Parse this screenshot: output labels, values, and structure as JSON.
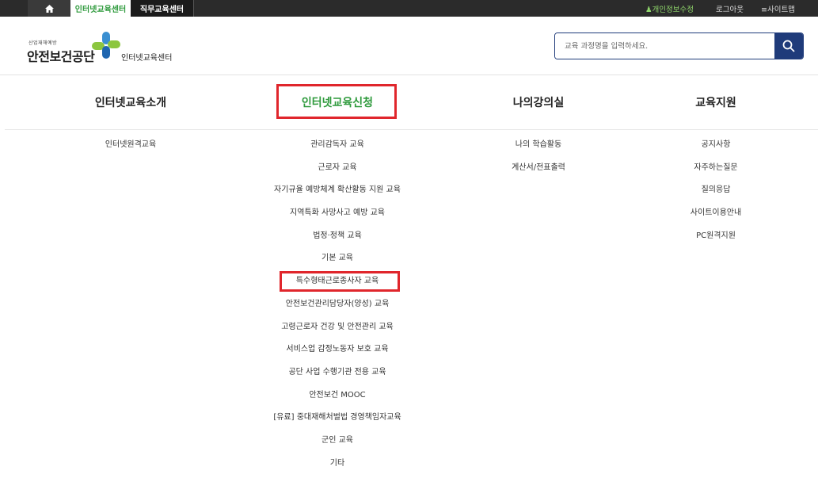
{
  "topbar": {
    "home_icon": "home-icon",
    "tab_internet": "인터넷교육센터",
    "tab_job": "직무교육센터",
    "edit_profile": "♟개인정보수정",
    "logout": "로그아웃",
    "sitemap": "≡사이트맵"
  },
  "header": {
    "logo_small": "산업재해예방",
    "logo_big": "안전보건공단",
    "logo_sub": "인터넷교육센터",
    "search_placeholder": "교육 과정명을 입력하세요."
  },
  "gnb": [
    {
      "label": "인터넷교육소개",
      "active": false
    },
    {
      "label": "인터넷교육신청",
      "active": true
    },
    {
      "label": "나의강의실",
      "active": false
    },
    {
      "label": "교육지원",
      "active": false
    }
  ],
  "menu": {
    "col1": [
      "인터넷원격교육"
    ],
    "col2": [
      "관리감독자 교육",
      "근로자 교육",
      "자기규율 예방체계 확산활동 지원 교육",
      "지역특화 사망사고 예방 교육",
      "법정·정책 교육",
      "기본 교육",
      "특수형태근로종사자 교육",
      "안전보건관리담당자(양성) 교육",
      "고령근로자 건강 및 안전관리 교육",
      "서비스업 감정노동자 보호 교육",
      "공단 사업 수행기관 전용 교육",
      "안전보건 MOOC",
      "[유료] 중대재해처벌법 경영책임자교육",
      "군인 교육",
      "기타"
    ],
    "col3": [
      "나의 학습활동",
      "계산서/전표출력"
    ],
    "col4": [
      "공지사항",
      "자주하는질문",
      "질의응답",
      "사이트이용안내",
      "PC원격지원"
    ]
  },
  "colors": {
    "accent_green": "#2e9a3c",
    "navy": "#1f3b7a",
    "highlight_red": "#e0262c"
  }
}
